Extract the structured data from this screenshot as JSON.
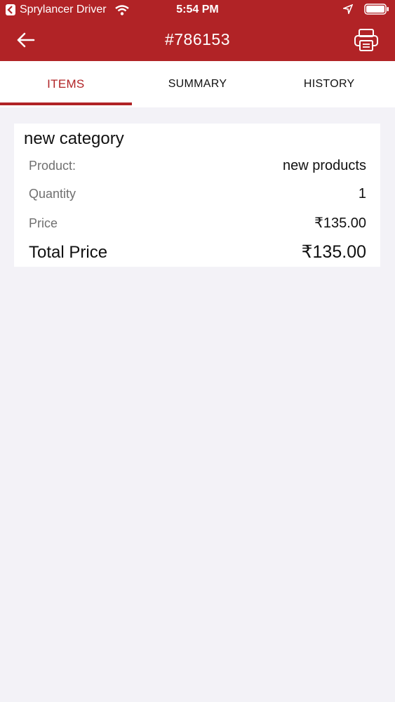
{
  "status_bar": {
    "carrier": "Sprylancer Driver",
    "time": "5:54 PM"
  },
  "nav": {
    "title": "#786153"
  },
  "tabs": [
    {
      "label": "ITEMS",
      "active": true
    },
    {
      "label": "SUMMARY",
      "active": false
    },
    {
      "label": "HISTORY",
      "active": false
    }
  ],
  "order": {
    "category": "new category",
    "product_label": "Product:",
    "product_value": "new products",
    "quantity_label": "Quantity",
    "quantity_value": "1",
    "price_label": "Price",
    "price_value": "₹135.00",
    "total_label": "Total Price",
    "total_value": "₹135.00"
  },
  "colors": {
    "brand": "#b12326",
    "background": "#f3f2f7"
  }
}
